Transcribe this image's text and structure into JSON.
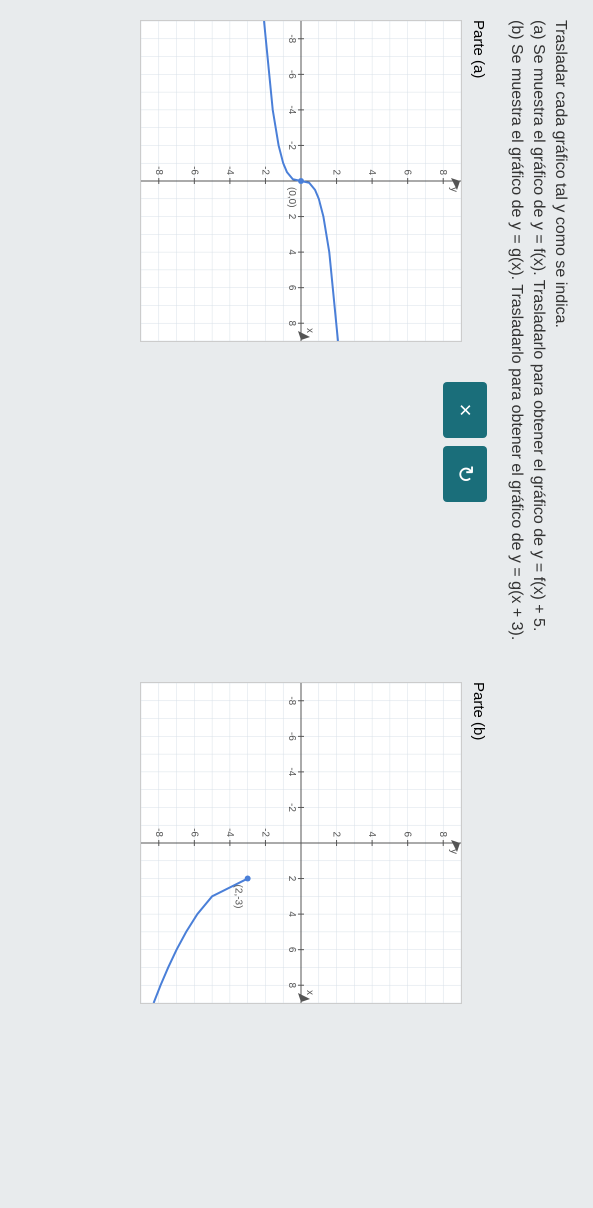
{
  "problem": {
    "intro": "Trasladar cada gráfico tal y como se indica.",
    "part_a": "(a) Se muestra el gráfico de y = f(x). Trasladarlo para obtener el gráfico de y = f(x) + 5.",
    "part_b": "(b) Se muestra el gráfico de y = g(x). Trasladarlo para obtener el gráfico de y = g(x + 3)."
  },
  "labels": {
    "parte_a": "Parte (a)",
    "parte_b": "Parte (b)"
  },
  "buttons": {
    "close": "×",
    "reset": "↻"
  },
  "chart_data": [
    {
      "type": "line",
      "title": "Parte (a)",
      "xlabel": "x",
      "ylabel": "y",
      "xlim": [
        -9,
        9
      ],
      "ylim": [
        -9,
        9
      ],
      "xticks": [
        -8,
        -6,
        -4,
        -2,
        2,
        4,
        6,
        8
      ],
      "yticks": [
        -8,
        -6,
        -4,
        -2,
        2,
        4,
        6,
        8
      ],
      "annotations": [
        {
          "text": "(0,0)",
          "x": 0,
          "y": 0
        }
      ],
      "series": [
        {
          "name": "f(x)",
          "color": "#4a7fd8",
          "points": [
            {
              "x": -9,
              "y": -2.08
            },
            {
              "x": -4,
              "y": -1.59
            },
            {
              "x": -2,
              "y": -1.26
            },
            {
              "x": -1,
              "y": -1.0
            },
            {
              "x": -0.5,
              "y": -0.79
            },
            {
              "x": -0.1,
              "y": -0.46
            },
            {
              "x": 0,
              "y": 0
            },
            {
              "x": 0.1,
              "y": 0.46
            },
            {
              "x": 0.5,
              "y": 0.79
            },
            {
              "x": 1,
              "y": 1.0
            },
            {
              "x": 2,
              "y": 1.26
            },
            {
              "x": 4,
              "y": 1.59
            },
            {
              "x": 9,
              "y": 2.08
            }
          ]
        }
      ]
    },
    {
      "type": "line",
      "title": "Parte (b)",
      "xlabel": "x",
      "ylabel": "y",
      "xlim": [
        -9,
        9
      ],
      "ylim": [
        -9,
        9
      ],
      "xticks": [
        -8,
        -6,
        -4,
        -2,
        2,
        4,
        6,
        8
      ],
      "yticks": [
        -8,
        -6,
        -4,
        -2,
        2,
        4,
        6,
        8
      ],
      "annotations": [
        {
          "text": "(2,-3)",
          "x": 2,
          "y": -3
        }
      ],
      "series": [
        {
          "name": "g(x)",
          "color": "#4a7fd8",
          "points": [
            {
              "x": 2,
              "y": -3
            },
            {
              "x": 3,
              "y": -5.0
            },
            {
              "x": 4,
              "y": -5.83
            },
            {
              "x": 5,
              "y": -6.46
            },
            {
              "x": 6,
              "y": -7.0
            },
            {
              "x": 7,
              "y": -7.47
            },
            {
              "x": 8,
              "y": -7.9
            },
            {
              "x": 9,
              "y": -8.29
            }
          ]
        }
      ]
    }
  ]
}
